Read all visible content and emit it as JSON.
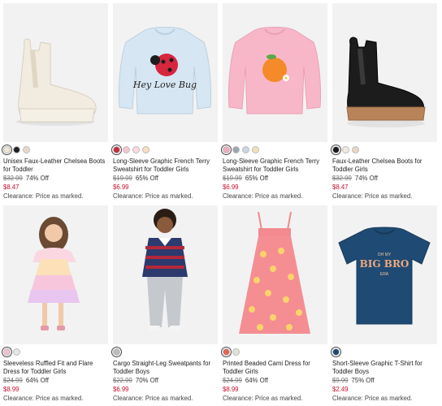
{
  "products": [
    {
      "name": "Unisex Faux-Leather Chelsea Boots for Toddler",
      "original_price": "$32.99",
      "discount": "74% Off",
      "sale_price": "$8.47",
      "clearance": "Clearance: Price as marked.",
      "swatches": [
        "#efe6d6",
        "#222222",
        "#e8d9c9"
      ],
      "selected_swatch": 0
    },
    {
      "name": "Long-Sleeve Graphic French Terry Sweatshirt for Toddler Girls",
      "original_price": "$19.99",
      "discount": "65% Off",
      "sale_price": "$6.99",
      "clearance": "Clearance: Price as marked.",
      "swatches": [
        "#c62d3c",
        "#f3c6cf",
        "#ffd9e0",
        "#f5e0b8"
      ],
      "selected_swatch": 0
    },
    {
      "name": "Long-Sleeve Graphic French Terry Sweatshirt for Toddler Girls",
      "original_price": "$19.99",
      "discount": "65% Off",
      "sale_price": "$6.99",
      "clearance": "Clearance: Price as marked.",
      "swatches": [
        "#f4a7c0",
        "#9aa5b0",
        "#c9d6e3",
        "#f3e1b5"
      ],
      "selected_swatch": 0
    },
    {
      "name": "Faux-Leather Chelsea Boots for Toddler Girls",
      "original_price": "$32.99",
      "discount": "74% Off",
      "sale_price": "$8.47",
      "clearance": "Clearance: Price as marked.",
      "swatches": [
        "#1a1a1a",
        "#f0e9de",
        "#e9d7c3"
      ],
      "selected_swatch": 0
    },
    {
      "name": "Sleeveless Ruffled Fit and Flare Dress for Toddler Girls",
      "original_price": "$24.99",
      "discount": "64% Off",
      "sale_price": "$8.99",
      "clearance": "Clearance: Price as marked.",
      "swatches": [
        "#f3c0cc",
        "#e6e6e6"
      ],
      "selected_swatch": 0
    },
    {
      "name": "Cargo Straight-Leg Sweatpants for Toddler Boys",
      "original_price": "$22.99",
      "discount": "70% Off",
      "sale_price": "$6.99",
      "clearance": "Clearance: Price as marked.",
      "swatches": [
        "#b9bcc0"
      ],
      "selected_swatch": 0
    },
    {
      "name": "Printed Beaded Cami Dress for Toddler Girls",
      "original_price": "$24.99",
      "discount": "64% Off",
      "sale_price": "$8.99",
      "clearance": "Clearance: Price as marked.",
      "swatches": [
        "#e8624f",
        "#dfe3d6"
      ],
      "selected_swatch": 0
    },
    {
      "name": "Short-Sleeve Graphic T-Shirt for Toddler Boys",
      "original_price": "$9.99",
      "discount": "75% Off",
      "sale_price": "$2.49",
      "clearance": "Clearance: Price as marked.",
      "swatches": [
        "#1e4a72"
      ],
      "selected_swatch": 0
    }
  ],
  "graphics": {
    "sweatshirt_text": "Hey Love Bug",
    "tshirt_text_top": "OH MY",
    "tshirt_text_main": "BIG BRO",
    "tshirt_text_bottom": "ERA"
  },
  "colors": {
    "sale_price": "#c8102e",
    "photo_background": "#f2f2f2"
  }
}
